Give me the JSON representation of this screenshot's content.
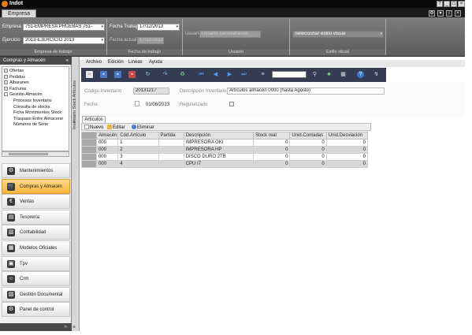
{
  "window": {
    "title": "Indot"
  },
  "ribbon": {
    "tab": "Empresa",
    "empresa": {
      "label_empresa": "Empresa",
      "empresa_value": "751-EMPRESA PRUEBAS 751-",
      "label_ejercicio": "Ejercicio",
      "ejercicio_value": "2013-EJERCICIO 2013",
      "group_label": "Empresa de trabajo"
    },
    "fecha": {
      "label_trabajo": "Fecha Trabajo",
      "trabajo_value": "17/12/2013",
      "label_actual": "Fecha actual",
      "actual_value": "17/12/2013",
      "group_label": "Fecha de trabajo"
    },
    "usuario": {
      "label": "Usuario",
      "value": "Usuario Demostracion",
      "group_label": "Usuario"
    },
    "estilo": {
      "value": "Seleccionar estilo visual",
      "group_label": "Estilo visual"
    }
  },
  "left_panel": {
    "header": "Compras y Almacén",
    "tree": [
      {
        "label": "Ofertas",
        "expander": "+"
      },
      {
        "label": "Pedidos",
        "expander": "+"
      },
      {
        "label": "Albaranes",
        "expander": "+"
      },
      {
        "label": "Facturas",
        "expander": "+"
      },
      {
        "label": "Gestión Almacén",
        "expander": "-"
      },
      {
        "label": "Procesos Inventario",
        "expander": ""
      },
      {
        "label": "Consulta de stocks",
        "expander": ""
      },
      {
        "label": "Ficha Movimientos Stock",
        "expander": ""
      },
      {
        "label": "Traspaso Entre Almacene",
        "expander": ""
      },
      {
        "label": "Números de Serie",
        "expander": ""
      }
    ],
    "modules": [
      {
        "label": "Mantenimientos",
        "icon": "gear-icon",
        "glyph": "⚙",
        "active": false
      },
      {
        "label": "Compras y Almacén",
        "icon": "cart-icon",
        "glyph": "🛒",
        "active": true
      },
      {
        "label": "Ventas",
        "icon": "euro-icon",
        "glyph": "€",
        "active": false
      },
      {
        "label": "Tesorería",
        "icon": "treasury-icon",
        "glyph": "▤",
        "active": false
      },
      {
        "label": "Contabilidad",
        "icon": "accounting-icon",
        "glyph": "▥",
        "active": false
      },
      {
        "label": "Modelos Oficiales",
        "icon": "forms-icon",
        "glyph": "▦",
        "active": false
      },
      {
        "label": "Tpv",
        "icon": "pos-icon",
        "glyph": "▣",
        "active": false
      },
      {
        "label": "Crm",
        "icon": "crm-icon",
        "glyph": "☺",
        "active": false
      },
      {
        "label": "Gestión Documental",
        "icon": "documents-icon",
        "glyph": "▧",
        "active": false
      },
      {
        "label": "Panel de control",
        "icon": "control-panel-icon",
        "glyph": "⚙",
        "active": false
      }
    ],
    "bottom": "»"
  },
  "side_tab": "Inventario Stock Artículos",
  "menu": [
    "Archivo",
    "Edición",
    "Lineas",
    "Ayuda"
  ],
  "form": {
    "codigo_label": "Código Inventario",
    "codigo_value": "20131217",
    "descripcion_label": "Descripción Inventario",
    "descripcion_value": "Artículos almacén 0000 (hasta Agosto)",
    "fecha_label": "Fecha",
    "fecha_value": "01/08/2013",
    "regularizado_label": "Regularizado"
  },
  "articulos_tab": "Artículos",
  "grid_actions": {
    "nuevo": "Nuevo",
    "editar": "Editar",
    "eliminar": "Eliminar"
  },
  "grid": {
    "columns": [
      "Almacén",
      "Cód.Artículo",
      "Partida",
      "Descripción",
      "Stock real",
      "Unid.Contadas",
      "Unid.Desviación"
    ],
    "rows": [
      [
        "000",
        "1",
        "",
        "IMPRESORA OKI",
        "0",
        "0",
        "0"
      ],
      [
        "000",
        "2",
        "",
        "IMPRESORA HP",
        "0",
        "0",
        "0"
      ],
      [
        "000",
        "3",
        "",
        "DISCO DURO 2TB",
        "0",
        "0",
        "0"
      ],
      [
        "000",
        "4",
        "",
        "CPU I7",
        "0",
        "0",
        "0"
      ]
    ]
  },
  "colors": {
    "toolbar_bg": "#353b52",
    "active_module": "#f6b43a",
    "ribbon_bg": "#6b6b6b"
  }
}
